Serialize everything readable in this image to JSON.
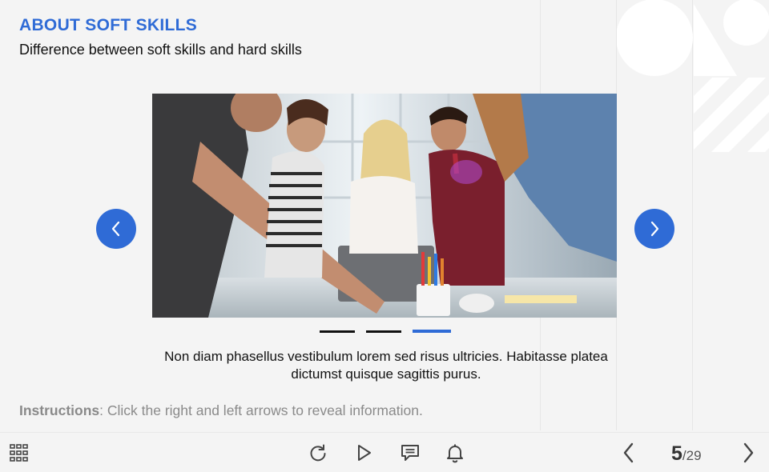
{
  "slide": {
    "title": "ABOUT SOFT SKILLS",
    "subtitle": "Difference between soft skills and hard skills",
    "caption": "Non diam phasellus vestibulum lorem sed risus ultricies. Habitasse platea dictumst quisque sagittis purus.",
    "instructions_label": "Instructions",
    "instructions_text": ": Click the right and left arrows to reveal information."
  },
  "carousel": {
    "slide_count": 3,
    "active_index": 2,
    "prev_icon": "chevron-left-icon",
    "next_icon": "chevron-right-icon"
  },
  "toolbar": {
    "menu_icon": "grid-menu-icon",
    "replay_icon": "replay-icon",
    "play_icon": "play-icon",
    "notes_icon": "comment-icon",
    "notify_icon": "bell-icon",
    "prev_icon": "chevron-left-icon",
    "next_icon": "chevron-right-icon",
    "current_page": "5",
    "total_pages": "/29"
  },
  "colors": {
    "accent": "#2f6bd6",
    "background": "#f4f4f4"
  }
}
